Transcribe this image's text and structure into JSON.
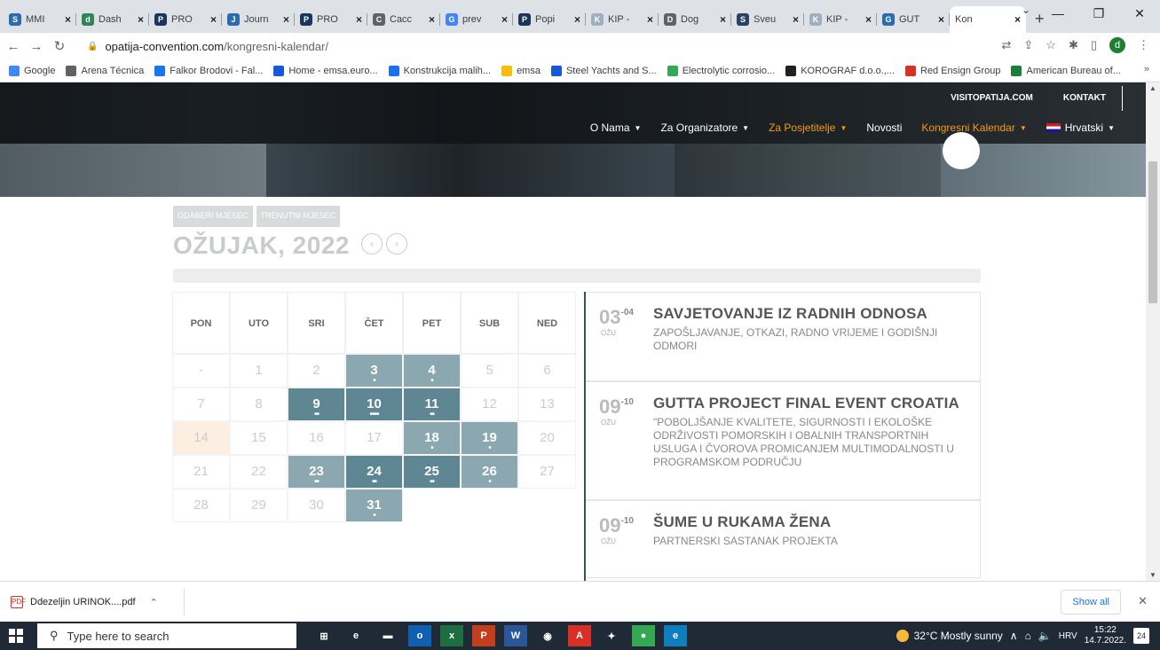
{
  "browser": {
    "tabs": [
      {
        "label": "MMI",
        "fav_color": "#2b6cb0",
        "fav_text": "S"
      },
      {
        "label": "Dash",
        "fav_color": "#2f855a",
        "fav_text": "d"
      },
      {
        "label": "PRO",
        "fav_color": "#1a365d",
        "fav_text": "P"
      },
      {
        "label": "Journ",
        "fav_color": "#2b6cb0",
        "fav_text": "J"
      },
      {
        "label": "PRO",
        "fav_color": "#1a365d",
        "fav_text": "P"
      },
      {
        "label": "Cacc",
        "fav_color": "#5f6368",
        "fav_text": "C"
      },
      {
        "label": "prev",
        "fav_color": "#4285f4",
        "fav_text": "G"
      },
      {
        "label": "Popi",
        "fav_color": "#1a365d",
        "fav_text": "P"
      },
      {
        "label": "KIP -",
        "fav_color": "#a0aec0",
        "fav_text": "K"
      },
      {
        "label": "Dog",
        "fav_color": "#5f6368",
        "fav_text": "D"
      },
      {
        "label": "Sveu",
        "fav_color": "#2a4365",
        "fav_text": "S"
      },
      {
        "label": "KIP -",
        "fav_color": "#a0aec0",
        "fav_text": "K"
      },
      {
        "label": "GUT",
        "fav_color": "#2b6cb0",
        "fav_text": "G"
      }
    ],
    "active_tab": "Kon",
    "new_tab": "+",
    "url_host": "opatija-convention.com",
    "url_path": "/kongresni-kalendar/",
    "profile_initial": "d",
    "bookmarks": [
      {
        "label": "Google",
        "color": "#4285f4"
      },
      {
        "label": "Arena Técnica",
        "color": "#5f6368"
      },
      {
        "label": "Falkor Brodovi - Fal...",
        "color": "#1a73e8"
      },
      {
        "label": "Home - emsa.euro...",
        "color": "#1a56db"
      },
      {
        "label": "Konstrukcija malih...",
        "color": "#1a73e8"
      },
      {
        "label": "emsa",
        "color": "#fbbc04"
      },
      {
        "label": "Steel Yachts and S...",
        "color": "#1a56db"
      },
      {
        "label": "Electrolytic corrosio...",
        "color": "#34a853"
      },
      {
        "label": "KOROGRAF d.o.o.,...",
        "color": "#202124"
      },
      {
        "label": "Red Ensign Group",
        "color": "#d93025"
      },
      {
        "label": "American Bureau of...",
        "color": "#188038"
      }
    ],
    "bookmarks_more": "»"
  },
  "site": {
    "toplinks": [
      "VISITOPATIJA.COM",
      "KONTAKT"
    ],
    "nav": [
      {
        "label": "O Nama",
        "orange": false
      },
      {
        "label": "Za Organizatore",
        "orange": false
      },
      {
        "label": "Za Posjetitelje",
        "orange": true
      },
      {
        "label": "Novosti",
        "orange": false,
        "nochev": true
      },
      {
        "label": "Kongresni Kalendar",
        "orange": true
      },
      {
        "label": "Hrvatski",
        "orange": false,
        "flag": true
      }
    ],
    "buttons": {
      "select_month": "ODABERI MJESEC",
      "current_month": "TRENUTNI MJESEC"
    },
    "month_title": "OŽUJAK, 2022",
    "prev": "‹",
    "next": "›",
    "weekdays": [
      "PON",
      "UTO",
      "SRI",
      "ČET",
      "PET",
      "SUB",
      "NED"
    ],
    "weeks": [
      [
        {
          "d": "-"
        },
        {
          "d": "1"
        },
        {
          "d": "2"
        },
        {
          "d": "3",
          "c": "ev1",
          "dots": "•"
        },
        {
          "d": "4",
          "c": "ev1",
          "dots": "•"
        },
        {
          "d": "5"
        },
        {
          "d": "6"
        }
      ],
      [
        {
          "d": "7"
        },
        {
          "d": "8"
        },
        {
          "d": "9",
          "c": "ev2",
          "dots": "••"
        },
        {
          "d": "10",
          "c": "ev2",
          "dots": "••••"
        },
        {
          "d": "11",
          "c": "ev2",
          "dots": "••"
        },
        {
          "d": "12"
        },
        {
          "d": "13"
        }
      ],
      [
        {
          "d": "14",
          "c": "today"
        },
        {
          "d": "15"
        },
        {
          "d": "16"
        },
        {
          "d": "17"
        },
        {
          "d": "18",
          "c": "ev1",
          "dots": "•"
        },
        {
          "d": "19",
          "c": "ev1",
          "dots": "•"
        },
        {
          "d": "20"
        }
      ],
      [
        {
          "d": "21"
        },
        {
          "d": "22"
        },
        {
          "d": "23",
          "c": "ev1",
          "dots": "••"
        },
        {
          "d": "24",
          "c": "ev2",
          "dots": "••"
        },
        {
          "d": "25",
          "c": "ev2",
          "dots": "••"
        },
        {
          "d": "26",
          "c": "ev1",
          "dots": "•"
        },
        {
          "d": "27"
        }
      ],
      [
        {
          "d": "28"
        },
        {
          "d": "29"
        },
        {
          "d": "30"
        },
        {
          "d": "31",
          "c": "ev1",
          "dots": "•"
        },
        {
          "d": "",
          "c": "blank"
        },
        {
          "d": "",
          "c": "blank"
        },
        {
          "d": "",
          "c": "blank"
        }
      ]
    ],
    "events": [
      {
        "day": "03",
        "end": "-04",
        "month": "OŽU",
        "title": "SAVJETOVANJE IZ RADNIH ODNOSA",
        "desc": "ZAPOŠLJAVANJE, OTKAZI, RADNO VRIJEME I GODIŠNJI ODMORI"
      },
      {
        "day": "09",
        "end": "-10",
        "month": "OŽU",
        "title": "GUTTA PROJECT FINAL EVENT CROATIA",
        "desc": "\"POBOLJŠANJE KVALITETE, SIGURNOSTI I EKOLOŠKE ODRŽIVOSTI POMORSKIH I OBALNIH TRANSPORTNIH USLUGA I ČVOROVA PROMICANJEM MULTIMODALNOSTI U PROGRAMSKOM PODRUČJU"
      },
      {
        "day": "09",
        "end": "-10",
        "month": "OŽU",
        "title": "ŠUME U RUKAMA ŽENA",
        "desc": "PARTNERSKI SASTANAK PROJEKTA"
      }
    ]
  },
  "downloads": {
    "file": "Ddezeljin URINOK....pdf",
    "show_all": "Show all"
  },
  "taskbar": {
    "search_placeholder": "Type here to search",
    "weather": "32°C  Mostly sunny",
    "lang": "HRV",
    "time": "15:22",
    "date": "14.7.2022.",
    "notif_count": "24",
    "apps": [
      {
        "t": "⊞",
        "c": "#1f2a36"
      },
      {
        "t": "e",
        "c": "#1f2a36"
      },
      {
        "t": "▬",
        "c": "#1f2a36"
      },
      {
        "t": "o",
        "c": "#0f5fb3"
      },
      {
        "t": "x",
        "c": "#1d6f42"
      },
      {
        "t": "P",
        "c": "#c43e1c"
      },
      {
        "t": "W",
        "c": "#2b579a"
      },
      {
        "t": "◉",
        "c": "#1f2a36"
      },
      {
        "t": "A",
        "c": "#d93025"
      },
      {
        "t": "✦",
        "c": "#1f2a36"
      },
      {
        "t": "●",
        "c": "#34a853"
      },
      {
        "t": "e",
        "c": "#0f7ec0"
      }
    ]
  }
}
